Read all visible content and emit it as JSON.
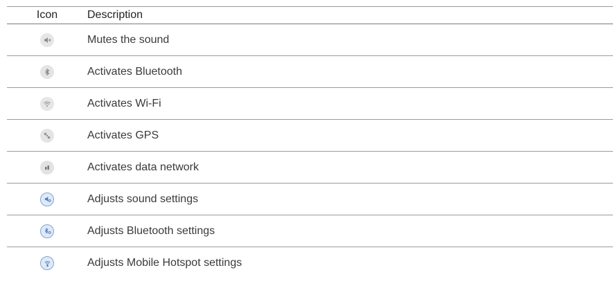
{
  "header": {
    "icon_col": "Icon",
    "description_col": "Description"
  },
  "rows": [
    {
      "icon": "mute-icon",
      "description": "Mutes the sound"
    },
    {
      "icon": "bluetooth-icon",
      "description": "Activates Bluetooth"
    },
    {
      "icon": "wifi-icon",
      "description": "Activates Wi-Fi"
    },
    {
      "icon": "gps-icon",
      "description": "Activates GPS"
    },
    {
      "icon": "data-network-icon",
      "description": "Activates data network"
    },
    {
      "icon": "sound-settings-icon",
      "description": "Adjusts sound settings"
    },
    {
      "icon": "bluetooth-settings-icon",
      "description": "Adjusts Bluetooth settings"
    },
    {
      "icon": "mobile-hotspot-settings-icon",
      "description": "Adjusts Mobile Hotspot settings"
    }
  ],
  "colors": {
    "grey_icon_bg": "#e4e4e4",
    "grey_icon_fg": "#8c8c8c",
    "blue_icon_bg": "#dfe9f7",
    "blue_icon_ring": "#7fa4d6",
    "blue_icon_fg": "#4f7fc2",
    "rule": "#9a9a9a"
  }
}
